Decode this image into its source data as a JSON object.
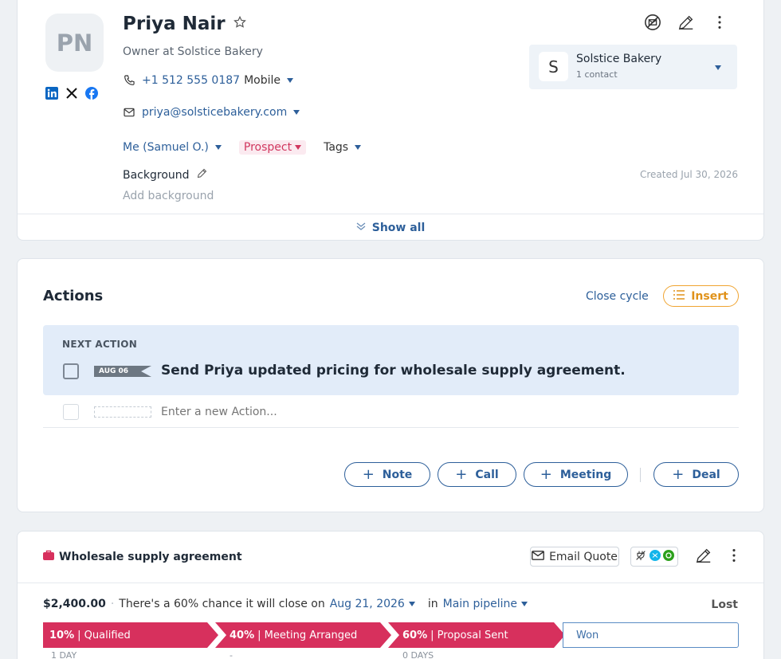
{
  "profile": {
    "initials": "PN",
    "name": "Priya Nair",
    "subtitle": "Owner at Solstice Bakery",
    "phone": "+1 512 555 0187",
    "phone_type": "Mobile",
    "email": "priya@solsticebakery.com",
    "owner": "Me (Samuel O.)",
    "status": "Prospect",
    "tags_label": "Tags",
    "background_label": "Background",
    "background_placeholder": "Add background",
    "created": "Created Jul 30, 2026",
    "show_all": "Show all",
    "company": {
      "initial": "S",
      "name": "Solstice Bakery",
      "count": "1 contact"
    },
    "icons": [
      "linkedin-icon",
      "x-icon",
      "facebook-icon",
      "no-email-icon",
      "edit-icon",
      "more-icon"
    ]
  },
  "actions": {
    "title": "Actions",
    "close_cycle": "Close cycle",
    "insert": "Insert",
    "next_label": "NEXT ACTION",
    "next_date": "AUG 06",
    "next_text": "Send Priya updated pricing for wholesale supply agreement.",
    "new_placeholder": "Enter a new Action...",
    "buttons": {
      "note": "Note",
      "call": "Call",
      "meeting": "Meeting",
      "deal": "Deal"
    }
  },
  "deal": {
    "title": "Wholesale supply agreement",
    "email_quote": "Email Quote",
    "amount": "$2,400.00",
    "chance_text": "There's a 60% chance it will close on",
    "close_date": "Aug 21, 2026",
    "in_text": "in",
    "pipeline": "Main pipeline",
    "lost": "Lost",
    "stages": [
      {
        "pct": "10%",
        "name": "Qualified",
        "duration": "1 DAY"
      },
      {
        "pct": "40%",
        "name": "Meeting Arranged",
        "duration": "-"
      },
      {
        "pct": "60%",
        "name": "Proposal Sent",
        "duration": "0 DAYS"
      }
    ],
    "won": "Won",
    "colors": {
      "accent": "#d7305d",
      "link": "#2d5f9a",
      "insert": "#f0a431"
    }
  }
}
